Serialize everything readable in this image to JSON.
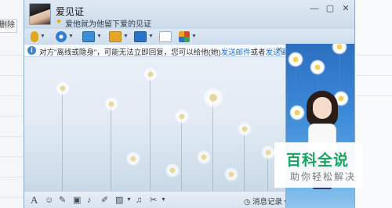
{
  "background_app": {
    "delete_button_label": "删除"
  },
  "header": {
    "contact_name": "爱见证",
    "signature": "爱他就为他留下爱的见证",
    "window_controls": [
      "minimize-icon",
      "maximize-icon",
      "close-icon"
    ]
  },
  "toolbar": {
    "items": [
      {
        "icon": "microphone-icon",
        "color": "#e2a51e"
      },
      {
        "icon": "video-camera-icon",
        "color": "#2e7fd1"
      },
      {
        "icon": "screen-share-icon",
        "color": "#3a8ddb"
      },
      {
        "icon": "folder-transfer-icon",
        "color": "#e4a629"
      },
      {
        "icon": "remote-desktop-icon",
        "color": "#2b73c7"
      },
      {
        "icon": "invite-contact-icon",
        "color": "#3aa84a"
      },
      {
        "icon": "app-grid-icon",
        "color": "#d9472f"
      }
    ]
  },
  "notice": {
    "text_before": "对方\"离线或隐身\"，可能无法立即回复，您可以给他(她)",
    "link_email": "发送邮件",
    "connector": "或者",
    "link_offline_file": "发送离线文件",
    "close_glyph": "✕"
  },
  "input_toolbar": {
    "font_glyph": "A",
    "history_label": "消息记录",
    "history_caret": "▾"
  },
  "watermark": {
    "main": "百科全说",
    "sub": "助你轻松解决"
  },
  "colors": {
    "link": "#1f6fd1",
    "watermark_green": "#1aa260",
    "show_panel_blue": "#3b88d6"
  }
}
